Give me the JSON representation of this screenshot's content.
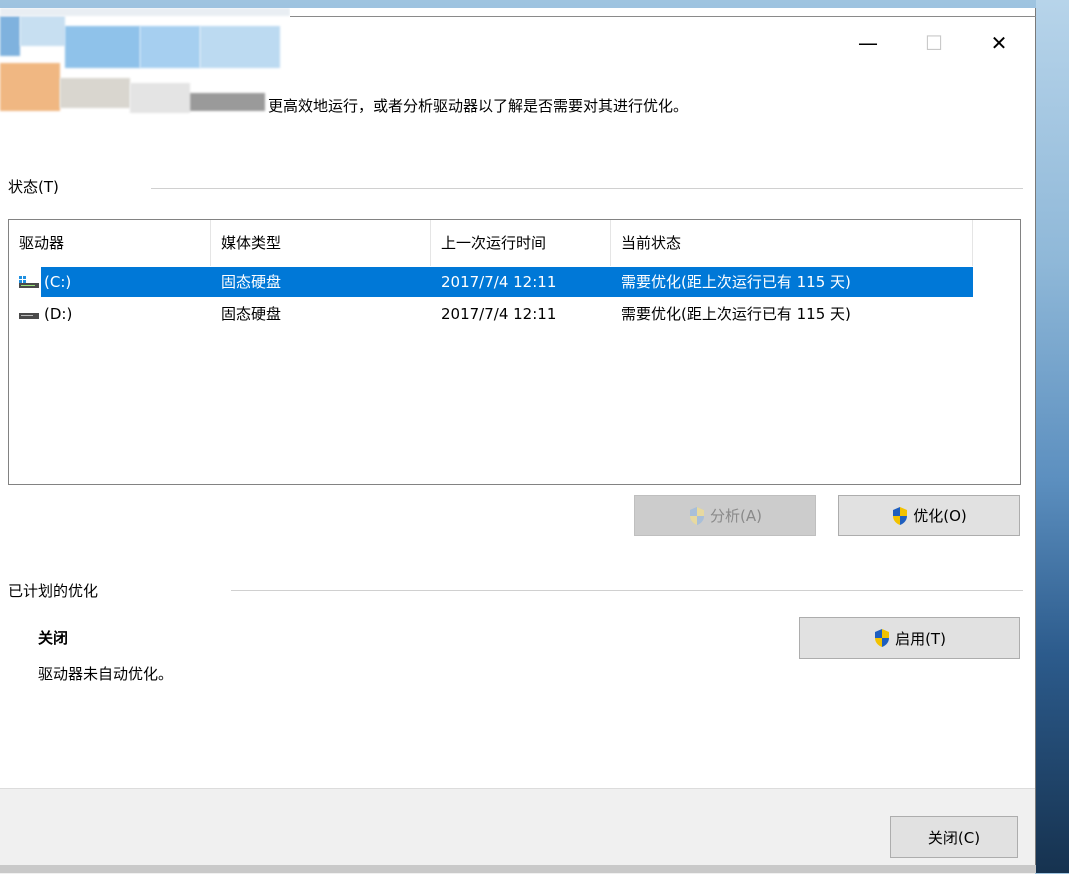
{
  "window": {
    "caption": {
      "minimize": "—",
      "maximize": "☐",
      "close": "✕"
    },
    "description": "更高效地运行，或者分析驱动器以了解是否需要对其进行优化。"
  },
  "status_section": {
    "label": "状态(T)",
    "columns": [
      "驱动器",
      "媒体类型",
      "上一次运行时间",
      "当前状态"
    ],
    "rows": [
      {
        "drive": "(C:)",
        "media": "固态硬盘",
        "last_run": "2017/7/4 12:11",
        "status": "需要优化(距上次运行已有 115 天)",
        "selected": true,
        "icon": "system-drive-icon"
      },
      {
        "drive": "(D:)",
        "media": "固态硬盘",
        "last_run": "2017/7/4 12:11",
        "status": "需要优化(距上次运行已有 115 天)",
        "selected": false,
        "icon": "drive-icon"
      }
    ],
    "analyze_label": "分析(A)",
    "optimize_label": "优化(O)"
  },
  "scheduled_section": {
    "label": "已计划的优化",
    "state": "关闭",
    "detail": "驱动器未自动优化。",
    "enable_label": "启用(T)"
  },
  "footer": {
    "close_label": "关闭(C)"
  },
  "colors": {
    "selection": "#0078d7",
    "shield_blue": "#1f5fbf",
    "shield_yellow": "#f2c200"
  }
}
